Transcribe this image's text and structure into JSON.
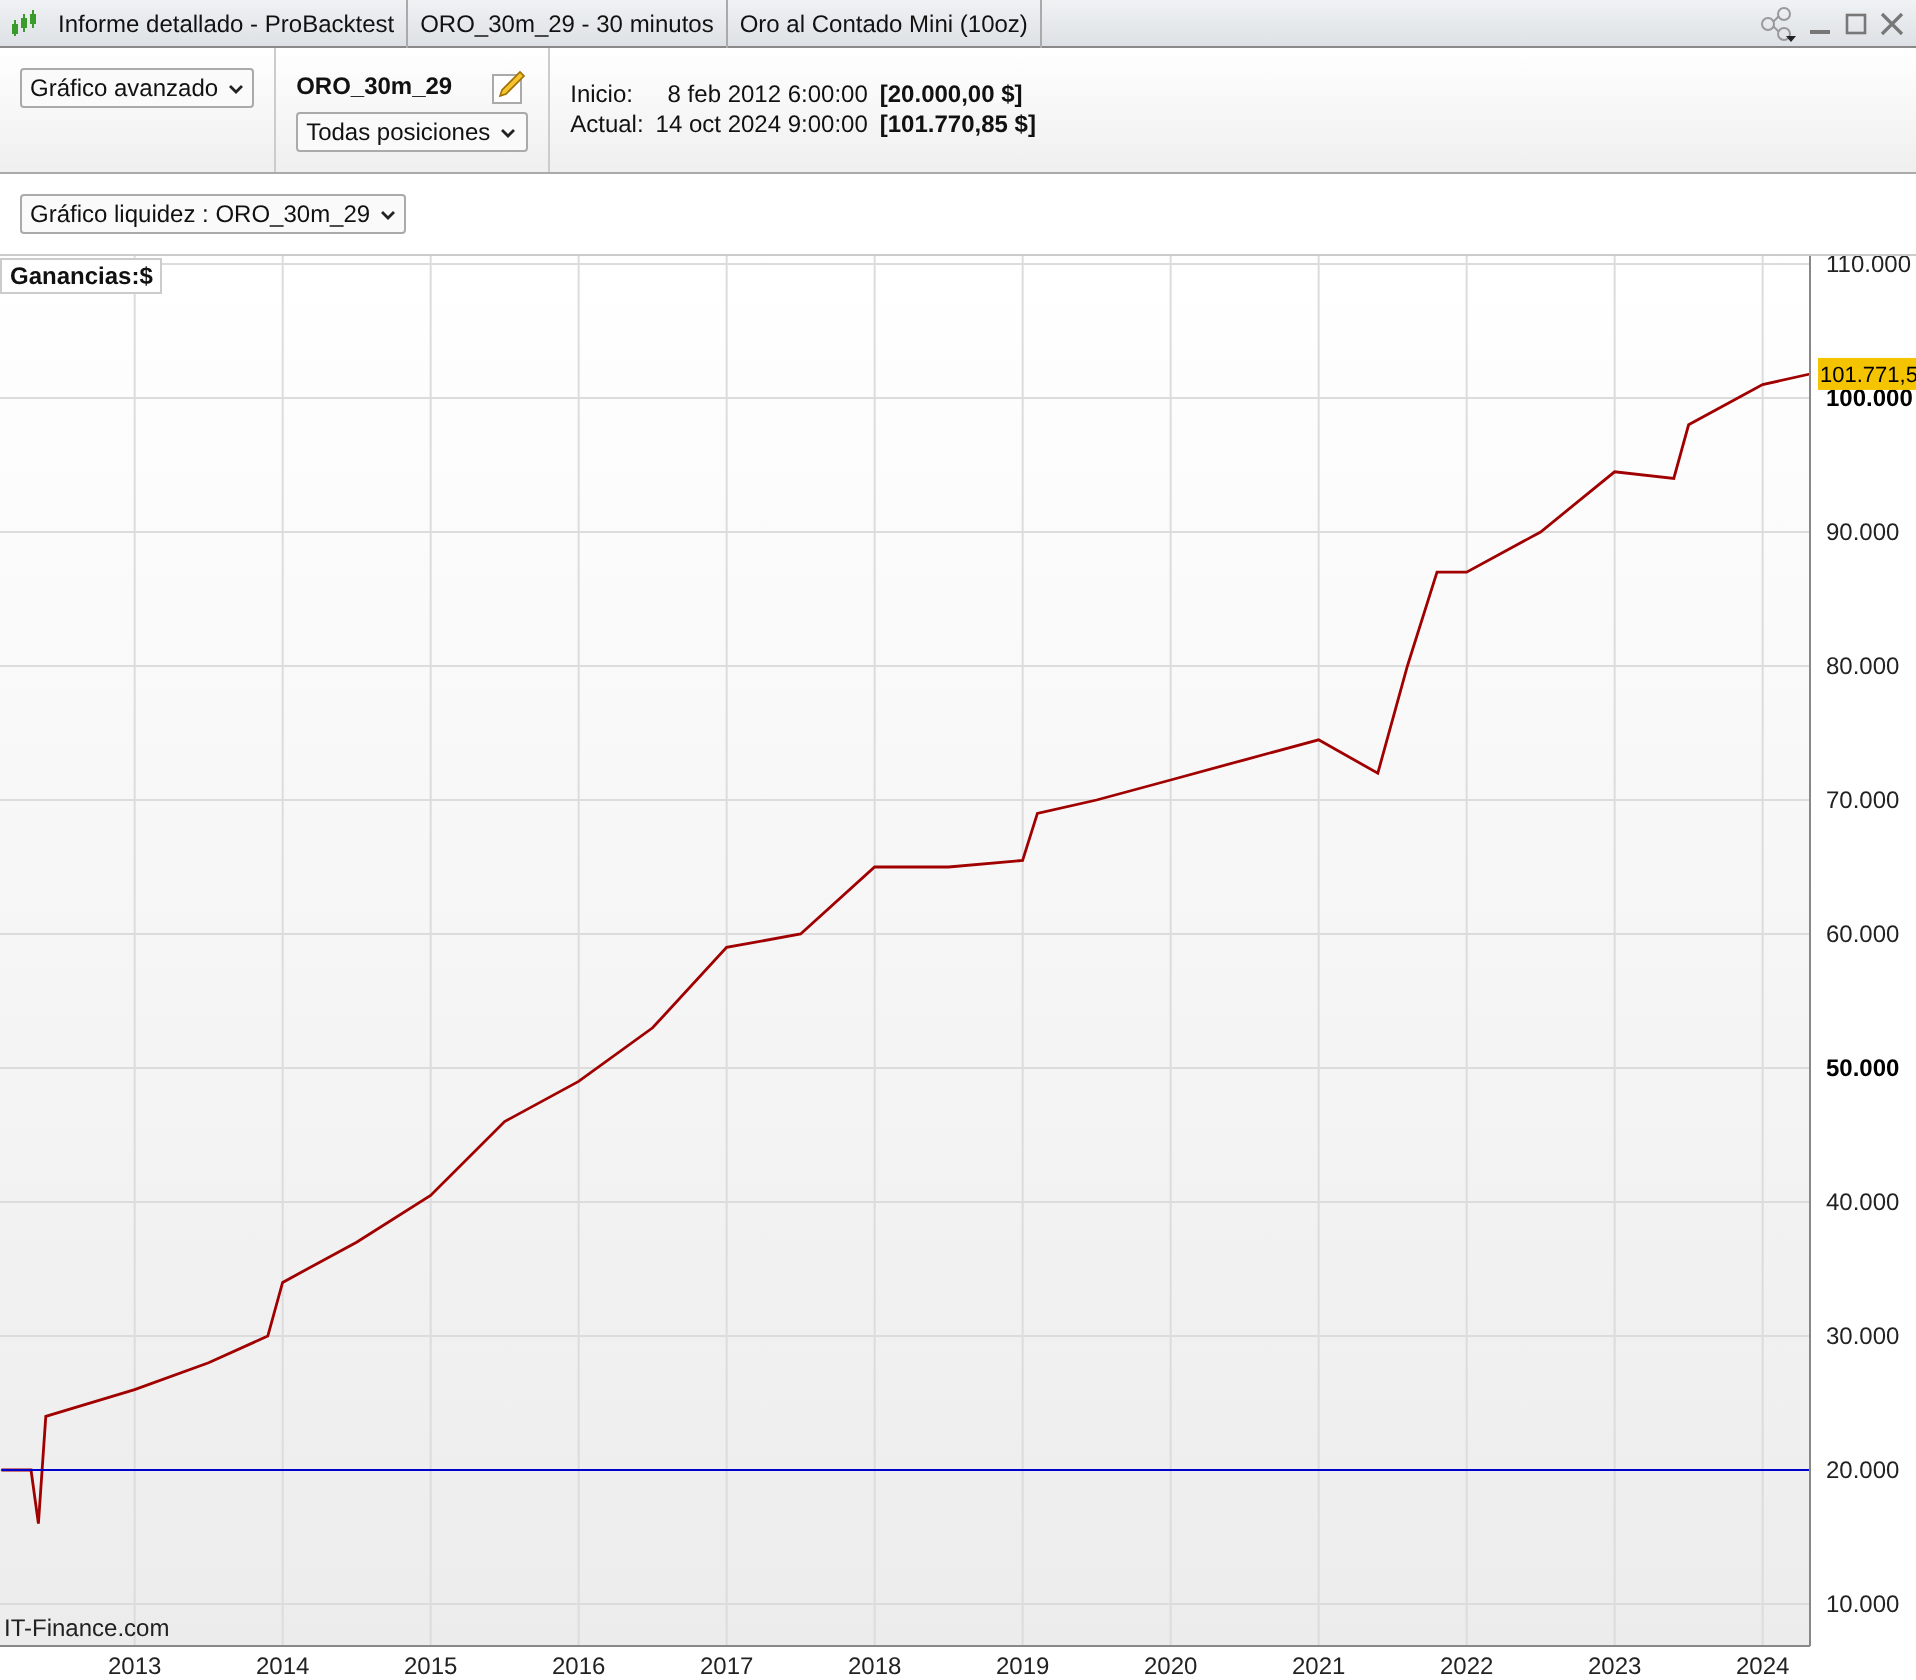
{
  "window": {
    "tabs": [
      "Informe detallado - ProBacktest",
      "ORO_30m_29 - 30 minutos",
      "Oro al Contado Mini (10oz)"
    ]
  },
  "toolbar": {
    "chart_mode": "Gráfico avanzado",
    "system_name": "ORO_30m_29",
    "positions": "Todas posiciones",
    "start": {
      "label": "Inicio:",
      "date": "8 feb 2012 6:00:00",
      "value": "[20.000,00 $]"
    },
    "current": {
      "label": "Actual:",
      "date": "14 oct 2024 9:00:00",
      "value": "[101.770,85 $]"
    }
  },
  "chart_selector": "Gráfico liquidez : ORO_30m_29",
  "chart": {
    "legend": "Ganancias:$",
    "last_value_label": "101.771,5",
    "credit": "IT-Finance.com",
    "chart_data": {
      "type": "line",
      "x": [
        2012.1,
        2012.3,
        2012.35,
        2012.4,
        2013.0,
        2013.5,
        2013.9,
        2014.0,
        2014.5,
        2015.0,
        2015.5,
        2016.0,
        2016.5,
        2017.0,
        2017.5,
        2018.0,
        2018.5,
        2019.0,
        2019.1,
        2019.5,
        2020.0,
        2020.5,
        2021.0,
        2021.4,
        2021.6,
        2021.8,
        2022.0,
        2022.5,
        2023.0,
        2023.4,
        2023.5,
        2024.0,
        2024.32
      ],
      "series": [
        {
          "color": "#a00000",
          "values": [
            20000,
            20000,
            16000,
            24000,
            26000,
            28000,
            30000,
            34000,
            37000,
            40500,
            46000,
            49000,
            53000,
            59000,
            60000,
            65000,
            65000,
            65500,
            69000,
            70000,
            71500,
            73000,
            74500,
            72000,
            80000,
            87000,
            87000,
            90000,
            94500,
            94000,
            98000,
            101000,
            101800
          ]
        },
        {
          "color": "#0000cc",
          "values": [
            20000,
            20000,
            20000,
            20000,
            20000,
            20000,
            20000,
            20000,
            20000,
            20000,
            20000,
            20000,
            20000,
            20000,
            20000,
            20000,
            20000,
            20000,
            20000,
            20000,
            20000,
            20000,
            20000,
            20000,
            20000,
            20000,
            20000,
            20000,
            20000,
            20000,
            20000,
            20000,
            20000
          ]
        }
      ],
      "xlim": [
        2012.09,
        2024.32
      ],
      "ylim": [
        6870,
        110600
      ],
      "grid": true,
      "xticks": [
        2013,
        2014,
        2015,
        2016,
        2017,
        2018,
        2019,
        2020,
        2021,
        2022,
        2023,
        2024
      ],
      "yticks": [
        {
          "value": 10000,
          "label": "10.000"
        },
        {
          "value": 20000,
          "label": "20.000"
        },
        {
          "value": 30000,
          "label": "30.000"
        },
        {
          "value": 40000,
          "label": "40.000"
        },
        {
          "value": 50000,
          "label": "50.000"
        },
        {
          "value": 60000,
          "label": "60.000"
        },
        {
          "value": 70000,
          "label": "70.000"
        },
        {
          "value": 80000,
          "label": "80.000"
        },
        {
          "value": 90000,
          "label": "90.000"
        },
        {
          "value": 100000,
          "label": "100.000"
        },
        {
          "value": 110000,
          "label": "110.000"
        }
      ]
    }
  }
}
